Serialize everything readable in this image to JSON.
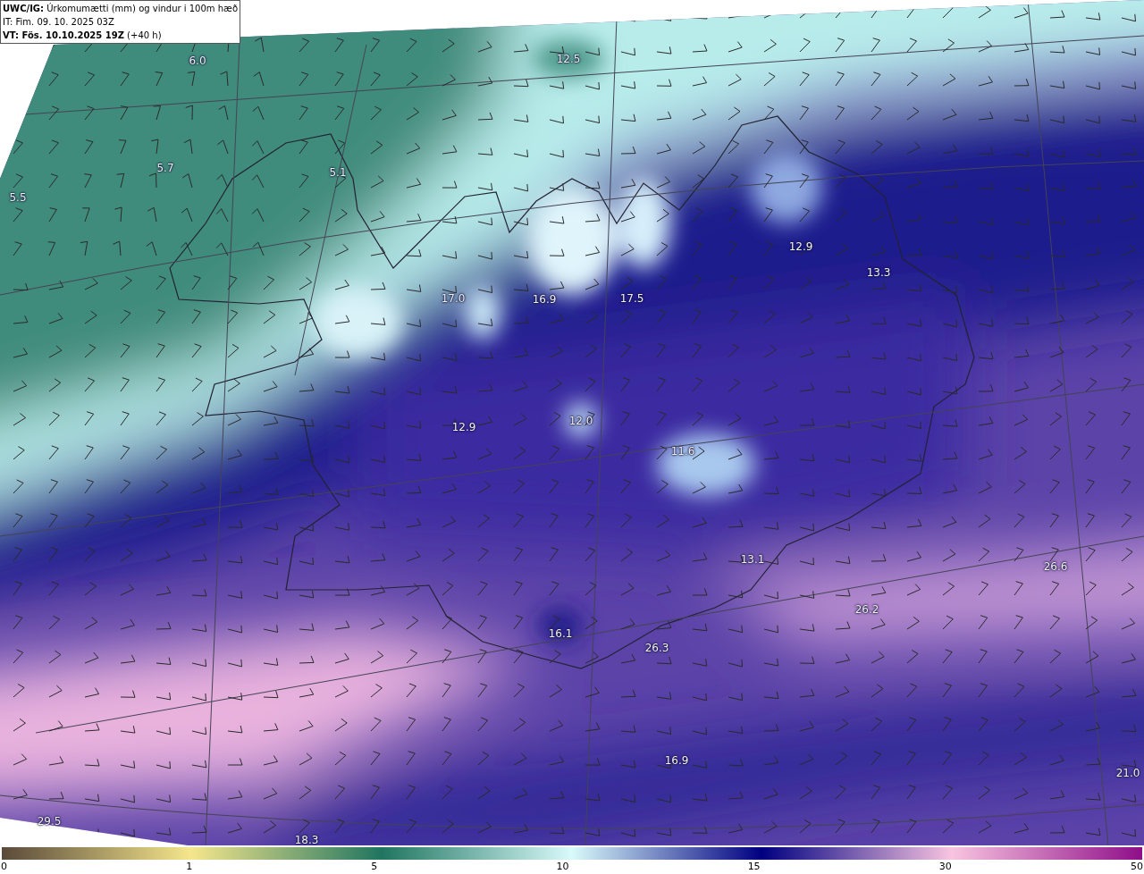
{
  "header": {
    "title": "**UWC/IG:** Úrkomumætti (mm) og vindur i 100m hæð",
    "issue_time": "IT: Fim. 09. 10. 2025 03Z",
    "valid_time": "**VT: Fös. 10.10.2025 19Z** (+40 h)"
  },
  "map_values": [
    "6.0",
    "12.5",
    "5.7",
    "5.1",
    "5.5",
    "17.0",
    "16.9",
    "17.5",
    "12.9",
    "13.3",
    "12.9",
    "12.0",
    "11.6",
    "13.1",
    "16.1",
    "26.3",
    "26.2",
    "26.6",
    "16.9",
    "21.0",
    "29.5",
    "18.3"
  ],
  "colorbar": {
    "ticks": [
      "0",
      "1",
      "5",
      "10",
      "15",
      "30",
      "50"
    ]
  }
}
